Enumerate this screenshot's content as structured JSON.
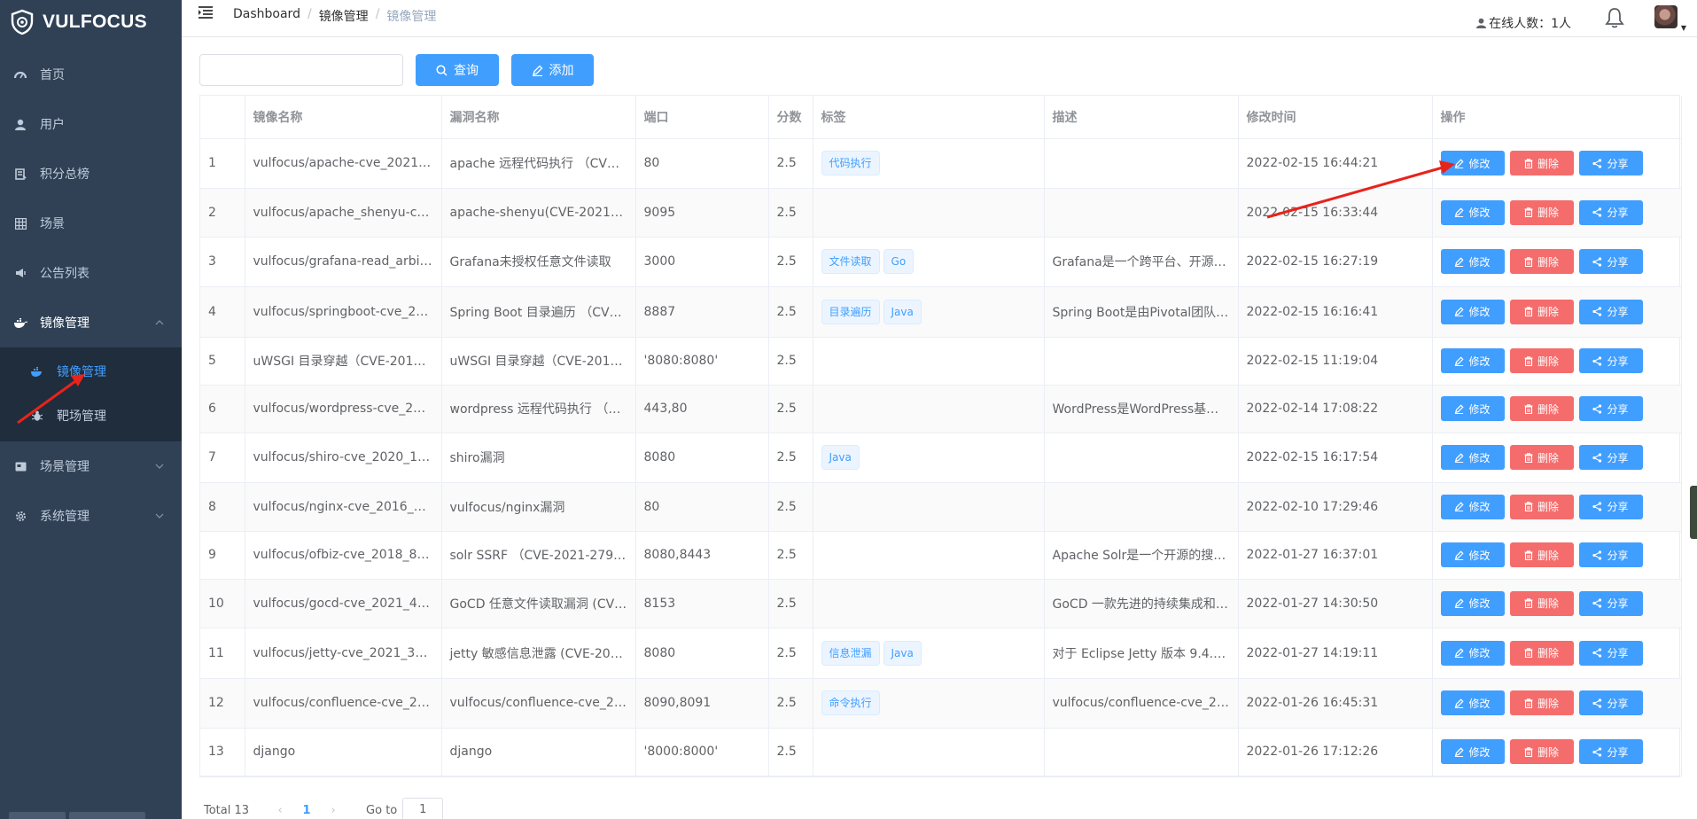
{
  "logo": {
    "text": "VULFOCUS"
  },
  "sidebar": {
    "items": [
      {
        "label": "首页",
        "icon": "dashboard-icon"
      },
      {
        "label": "用户",
        "icon": "user-icon"
      },
      {
        "label": "积分总榜",
        "icon": "ranking-icon"
      },
      {
        "label": "场景",
        "icon": "grid-icon"
      },
      {
        "label": "公告列表",
        "icon": "megaphone-icon"
      },
      {
        "label": "镜像管理",
        "icon": "docker-icon",
        "expanded": true
      },
      {
        "label": "场景管理",
        "icon": "scene-icon"
      },
      {
        "label": "系统管理",
        "icon": "gear-icon"
      }
    ],
    "sub_items": [
      {
        "label": "镜像管理",
        "icon": "docker-icon",
        "active": true
      },
      {
        "label": "靶场管理",
        "icon": "bug-icon"
      }
    ]
  },
  "navbar": {
    "breadcrumb": [
      "Dashboard",
      "镜像管理",
      "镜像管理"
    ],
    "online_label": "在线人数：1人"
  },
  "toolbar": {
    "search_value": "",
    "search_label": "查询",
    "add_label": "添加"
  },
  "table": {
    "headers": [
      "",
      "镜像名称",
      "漏洞名称",
      "端口",
      "分数",
      "标签",
      "描述",
      "修改时间",
      "操作"
    ],
    "rows": [
      {
        "no": "1",
        "image": "vulfocus/apache-cve_2021_4…",
        "vuln": "apache 远程代码执行 （CVE…",
        "port": "80",
        "score": "2.5",
        "tags": [
          "代码执行"
        ],
        "desc": "",
        "time": "2022-02-15 16:44:21"
      },
      {
        "no": "2",
        "image": "vulfocus/apache_shenyu-ce_…",
        "vuln": "apache-shenyu(CVE-2021-3…",
        "port": "9095",
        "score": "2.5",
        "tags": [],
        "desc": "",
        "time": "2022-02-15 16:33:44"
      },
      {
        "no": "3",
        "image": "vulfocus/grafana-read_arbitra…",
        "vuln": "Grafana未授权任意文件读取",
        "port": "3000",
        "score": "2.5",
        "tags": [
          "文件读取",
          "Go"
        ],
        "desc": "Grafana是一个跨平台、开源…",
        "time": "2022-02-15 16:27:19"
      },
      {
        "no": "4",
        "image": "vulfocus/springboot-cve_202…",
        "vuln": "Spring Boot 目录遍历 （CVE…",
        "port": "8887",
        "score": "2.5",
        "tags": [
          "目录遍历",
          "Java"
        ],
        "desc": "Spring Boot是由Pivotal团队…",
        "time": "2022-02-15 16:16:41"
      },
      {
        "no": "5",
        "image": "uWSGI 目录穿越（CVE-2018…",
        "vuln": "uWSGI 目录穿越（CVE-201…",
        "port": "'8080:8080'",
        "score": "2.5",
        "tags": [],
        "desc": "",
        "time": "2022-02-15 11:19:04"
      },
      {
        "no": "6",
        "image": "vulfocus/wordpress-cve_2019…",
        "vuln": "wordpress 远程代码执行 （C…",
        "port": "443,80",
        "score": "2.5",
        "tags": [],
        "desc": "WordPress是WordPress基金…",
        "time": "2022-02-14 17:08:22"
      },
      {
        "no": "7",
        "image": "vulfocus/shiro-cve_2020_119…",
        "vuln": "shiro漏洞",
        "port": "8080",
        "score": "2.5",
        "tags": [
          "Java"
        ],
        "desc": "",
        "time": "2022-02-15 16:17:54"
      },
      {
        "no": "8",
        "image": "vulfocus/nginx-cve_2016_124…",
        "vuln": "vulfocus/nginx漏洞",
        "port": "80",
        "score": "2.5",
        "tags": [],
        "desc": "",
        "time": "2022-02-10 17:29:46"
      },
      {
        "no": "9",
        "image": "vulfocus/ofbiz-cve_2018_803…",
        "vuln": "solr SSRF （CVE-2021-2790…",
        "port": "8080,8443",
        "score": "2.5",
        "tags": [],
        "desc": "Apache Solr是一个开源的搜…",
        "time": "2022-01-27 16:37:01"
      },
      {
        "no": "10",
        "image": "vulfocus/gocd-cve_2021_432…",
        "vuln": "GoCD 任意文件读取漏洞 (CV…",
        "port": "8153",
        "score": "2.5",
        "tags": [],
        "desc": "GoCD 一款先进的持续集成和…",
        "time": "2022-01-27 14:30:50"
      },
      {
        "no": "11",
        "image": "vulfocus/jetty-cve_2021_3442…",
        "vuln": "jetty 敏感信息泄露 (CVE-202…",
        "port": "8080",
        "score": "2.5",
        "tags": [
          "信息泄漏",
          "Java"
        ],
        "desc": "对于 Eclipse Jetty 版本 9.4.3…",
        "time": "2022-01-27 14:19:11"
      },
      {
        "no": "12",
        "image": "vulfocus/confluence-cve_201…",
        "vuln": "vulfocus/confluence-cve_201…",
        "port": "8090,8091",
        "score": "2.5",
        "tags": [
          "命令执行"
        ],
        "desc": "vulfocus/confluence-cve_201…",
        "time": "2022-01-26 16:45:31"
      },
      {
        "no": "13",
        "image": "django",
        "vuln": "django",
        "port": "'8000:8000'",
        "score": "2.5",
        "tags": [],
        "desc": "",
        "time": "2022-01-26 17:12:26"
      }
    ],
    "actions": {
      "edit": "修改",
      "delete": "删除",
      "share": "分享"
    }
  },
  "pagination": {
    "total": "Total 13",
    "page": "1",
    "goto_label": "Go to",
    "goto_value": "1"
  },
  "colors": {
    "sidebar_bg": "#304156",
    "submenu_bg": "#1f2d3d",
    "primary": "#409eff",
    "danger": "#f56c6c",
    "annotation": "#e8231b"
  }
}
